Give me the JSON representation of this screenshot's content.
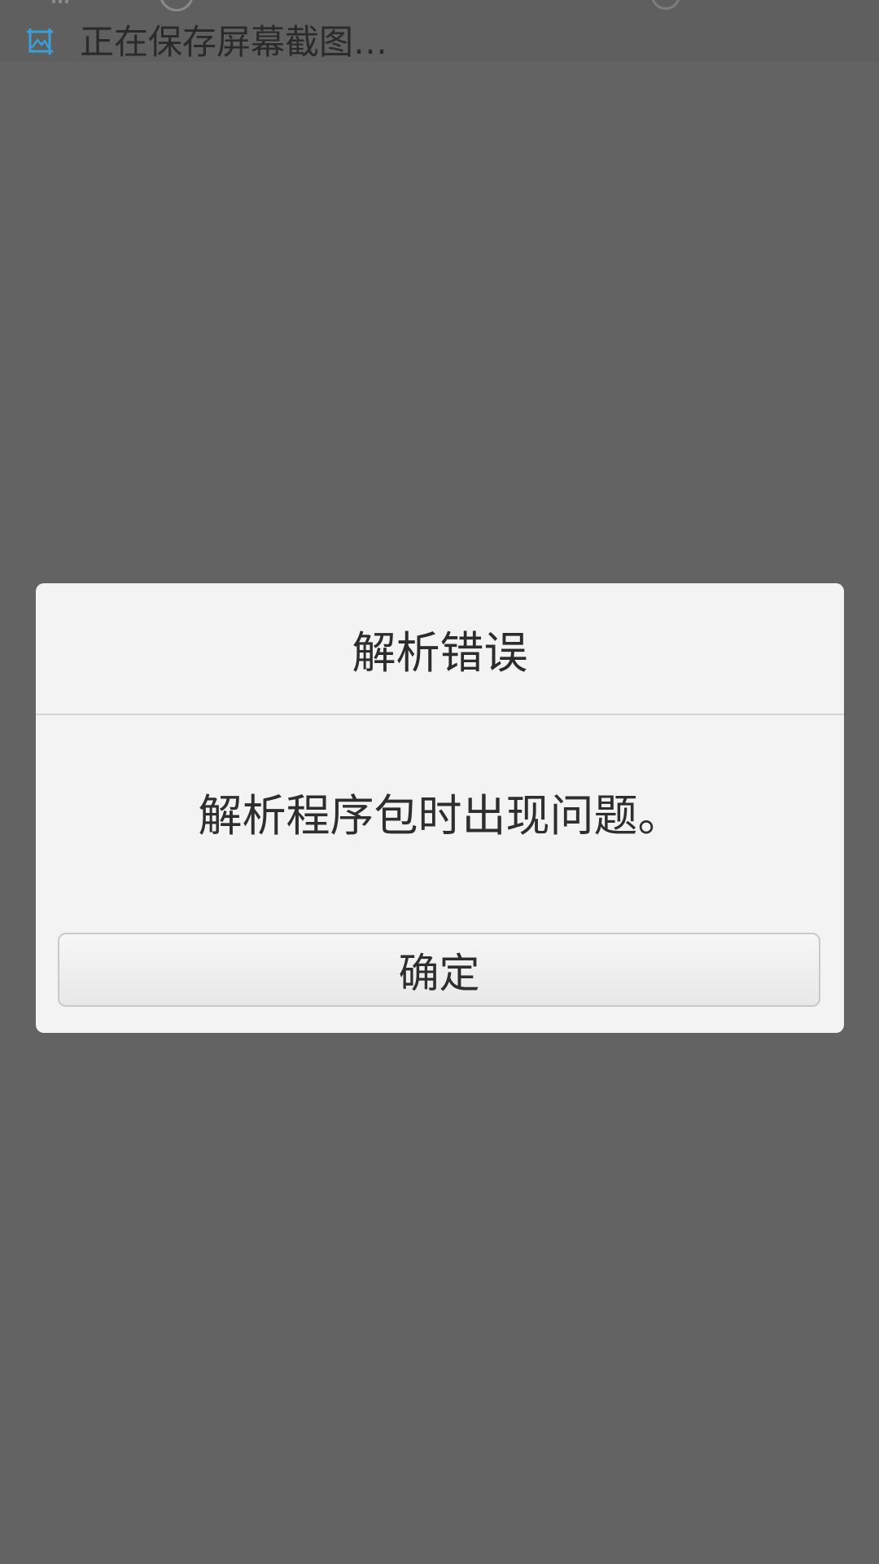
{
  "notification": {
    "icon": "screenshot-icon",
    "text": "正在保存屏幕截图…"
  },
  "dialog": {
    "title": "解析错误",
    "message": "解析程序包时出现问题。",
    "ok_label": "确定"
  },
  "colors": {
    "overlay": "#636363",
    "dialog_bg": "#f3f3f3",
    "accent_icon": "#3a9fd6"
  }
}
